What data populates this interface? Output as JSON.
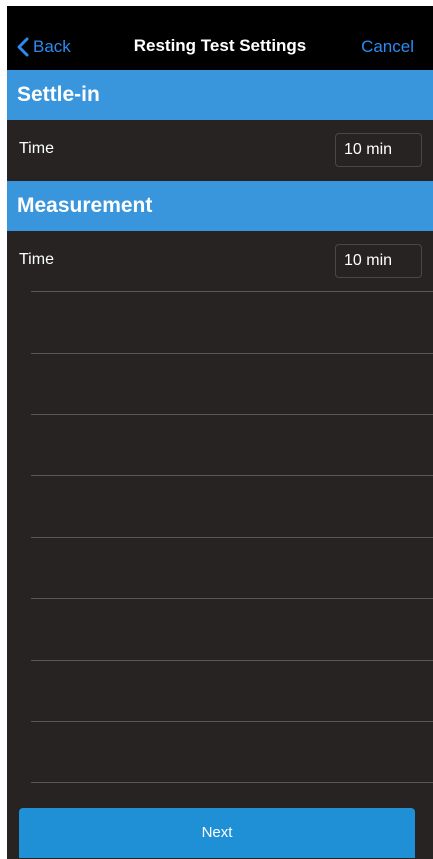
{
  "nav": {
    "back_label": "Back",
    "title": "Resting Test Settings",
    "cancel_label": "Cancel"
  },
  "sections": [
    {
      "title": "Settle-in",
      "row": {
        "label": "Time",
        "value": "10 min"
      }
    },
    {
      "title": "Measurement",
      "row": {
        "label": "Time",
        "value": "10 min"
      }
    }
  ],
  "footer": {
    "next_label": "Next"
  },
  "colors": {
    "accent": "#2a8bf2",
    "section_header": "#3a96dc",
    "background": "#262322",
    "button": "#1f8fd6"
  }
}
